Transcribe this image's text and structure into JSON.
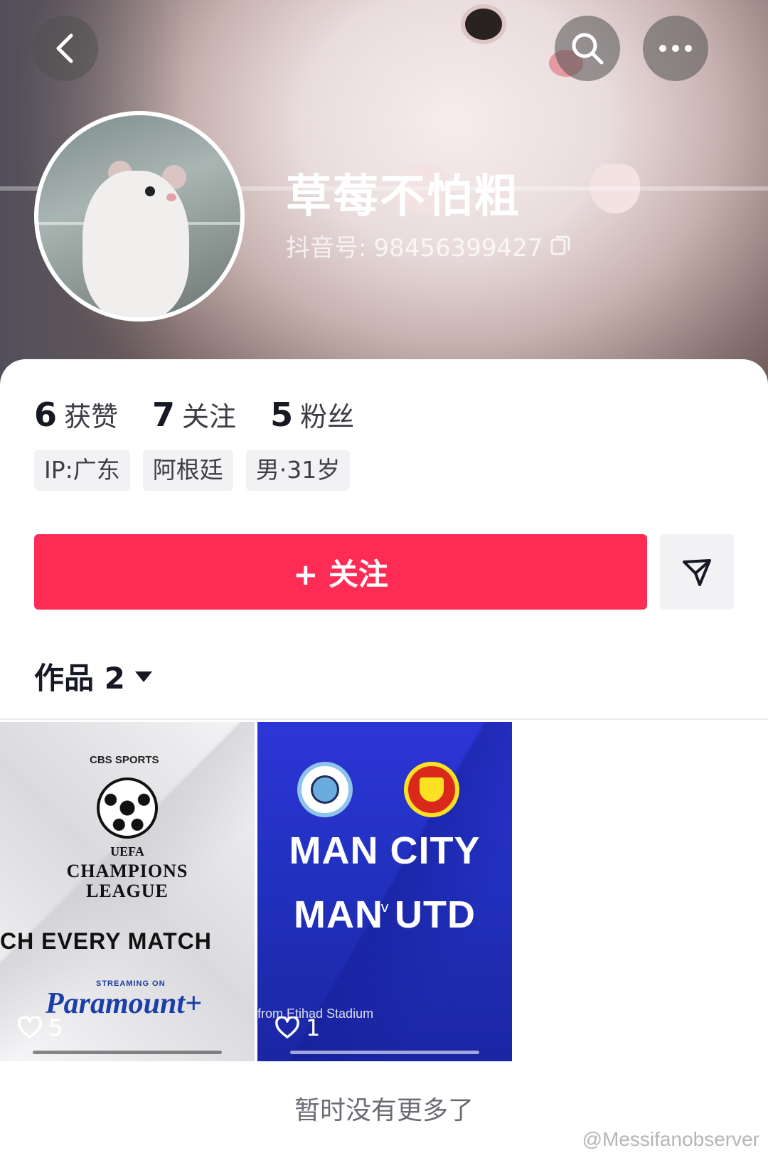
{
  "profile": {
    "nickname": "草莓不怕粗",
    "douyin_id_label": "抖音号:",
    "douyin_id": "98456399427"
  },
  "stats": [
    {
      "value": "6",
      "label": "获赞"
    },
    {
      "value": "7",
      "label": "关注"
    },
    {
      "value": "5",
      "label": "粉丝"
    }
  ],
  "tags": [
    "IP:广东",
    "阿根廷",
    "男·31岁"
  ],
  "actions": {
    "follow_label": "+ 关注"
  },
  "works": {
    "label": "作品 2",
    "items": [
      {
        "cbs": "CBS SPORTS",
        "uefa": "UEFA",
        "title": "CHAMPIONS\nLEAGUE",
        "slogan": "CH EVERY MATCH",
        "streaming": "STREAMING ON",
        "brand": "Paramount+",
        "likes": "5"
      },
      {
        "line1": "MAN CITY",
        "v": "v",
        "line2": "MAN UTD",
        "venue": "from Etihad Stadium",
        "likes": "1"
      }
    ]
  },
  "footer": {
    "no_more": "暂时没有更多了",
    "watermark": "@Messifanobserver"
  },
  "icons": [
    "back-icon",
    "search-icon",
    "more-icon",
    "copy-icon",
    "share-icon",
    "dropdown-icon",
    "heart-icon"
  ],
  "colors": {
    "accent": "#fe2c55",
    "tag_bg": "#f2f2f4"
  }
}
